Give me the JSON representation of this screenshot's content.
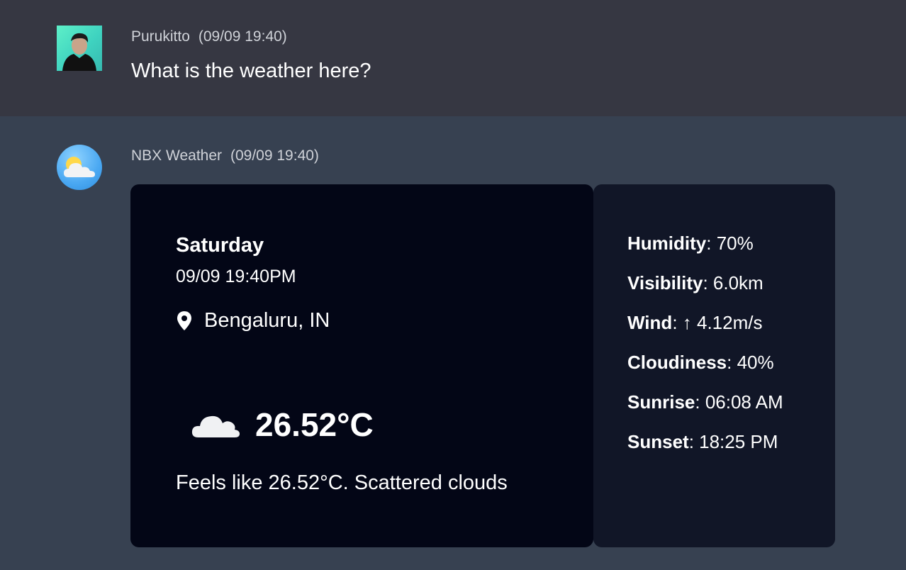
{
  "user_message": {
    "author": "Purukitto",
    "timestamp": "(09/09 19:40)",
    "text": "What is the weather here?"
  },
  "bot_message": {
    "author": "NBX Weather",
    "timestamp": "(09/09 19:40)",
    "weather": {
      "day": "Saturday",
      "datetime": "09/09 19:40PM",
      "location": "Bengaluru, IN",
      "temperature": "26.52°C",
      "description": "Feels like 26.52°C. Scattered clouds",
      "icon": "cloud-icon"
    },
    "stats": [
      {
        "label": "Humidity",
        "value": "70%"
      },
      {
        "label": "Visibility",
        "value": "6.0km"
      },
      {
        "label": "Wind",
        "value": "↑ 4.12m/s"
      },
      {
        "label": "Cloudiness",
        "value": "40%"
      },
      {
        "label": "Sunrise",
        "value": "06:08 AM"
      },
      {
        "label": "Sunset",
        "value": "18:25 PM"
      }
    ]
  },
  "colors": {
    "user_bg": "#363742",
    "bot_bg": "#374151",
    "card_main_bg": "#030616",
    "card_side_bg": "#111627"
  }
}
